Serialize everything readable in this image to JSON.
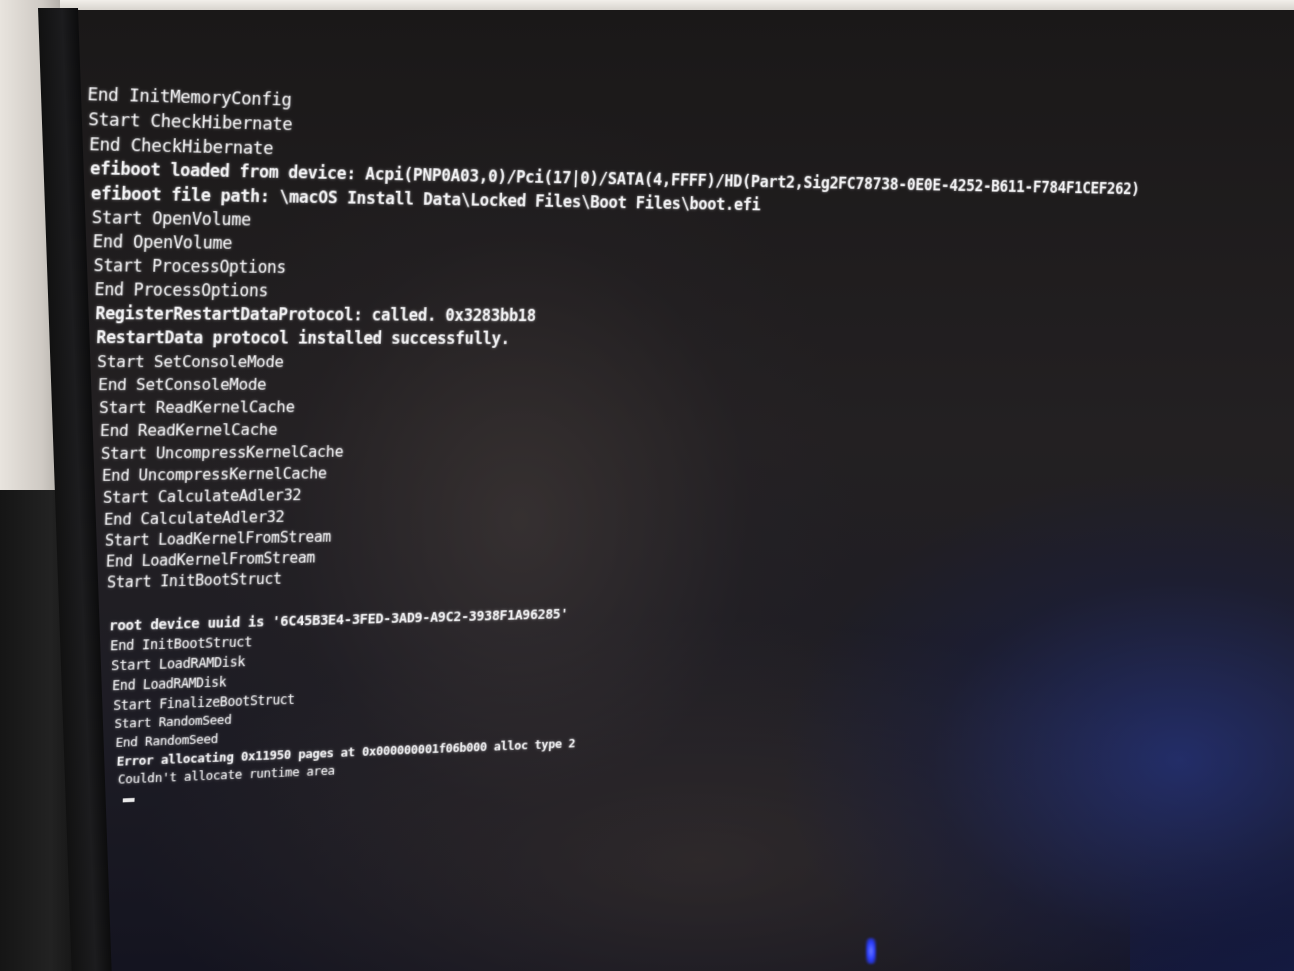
{
  "console": {
    "lines_top": [
      "End InitMemoryConfig",
      "Start CheckHibernate",
      "End CheckHibernate",
      "efiboot loaded from device: Acpi(PNP0A03,0)/Pci(17|0)/SATA(4,FFFF)/HD(Part2,Sig2FC78738-0E0E-4252-B611-F784F1CEF262)",
      "efiboot file path: \\macOS Install Data\\Locked Files\\Boot Files\\boot.efi",
      "Start OpenVolume",
      "End OpenVolume",
      "Start ProcessOptions",
      "End ProcessOptions",
      "RegisterRestartDataProtocol: called. 0x3283bb18",
      "RestartData protocol installed successfully.",
      "Start SetConsoleMode",
      "End SetConsoleMode",
      "Start ReadKernelCache",
      "End ReadKernelCache",
      "Start UncompressKernelCache",
      "End UncompressKernelCache",
      "Start CalculateAdler32",
      "End CalculateAdler32",
      "Start LoadKernelFromStream",
      "End LoadKernelFromStream",
      "Start InitBootStruct"
    ],
    "lines_bottom": [
      "root device uuid is '6C45B3E4-3FED-3AD9-A9C2-3938F1A96285'",
      "End InitBootStruct",
      "Start LoadRAMDisk",
      "End LoadRAMDisk",
      "Start FinalizeBootStruct",
      "Start RandomSeed",
      "End RandomSeed",
      "Error allocating 0x11950 pages at 0x000000001f06b000 alloc type 2",
      "Couldn't allocate runtime area"
    ]
  }
}
